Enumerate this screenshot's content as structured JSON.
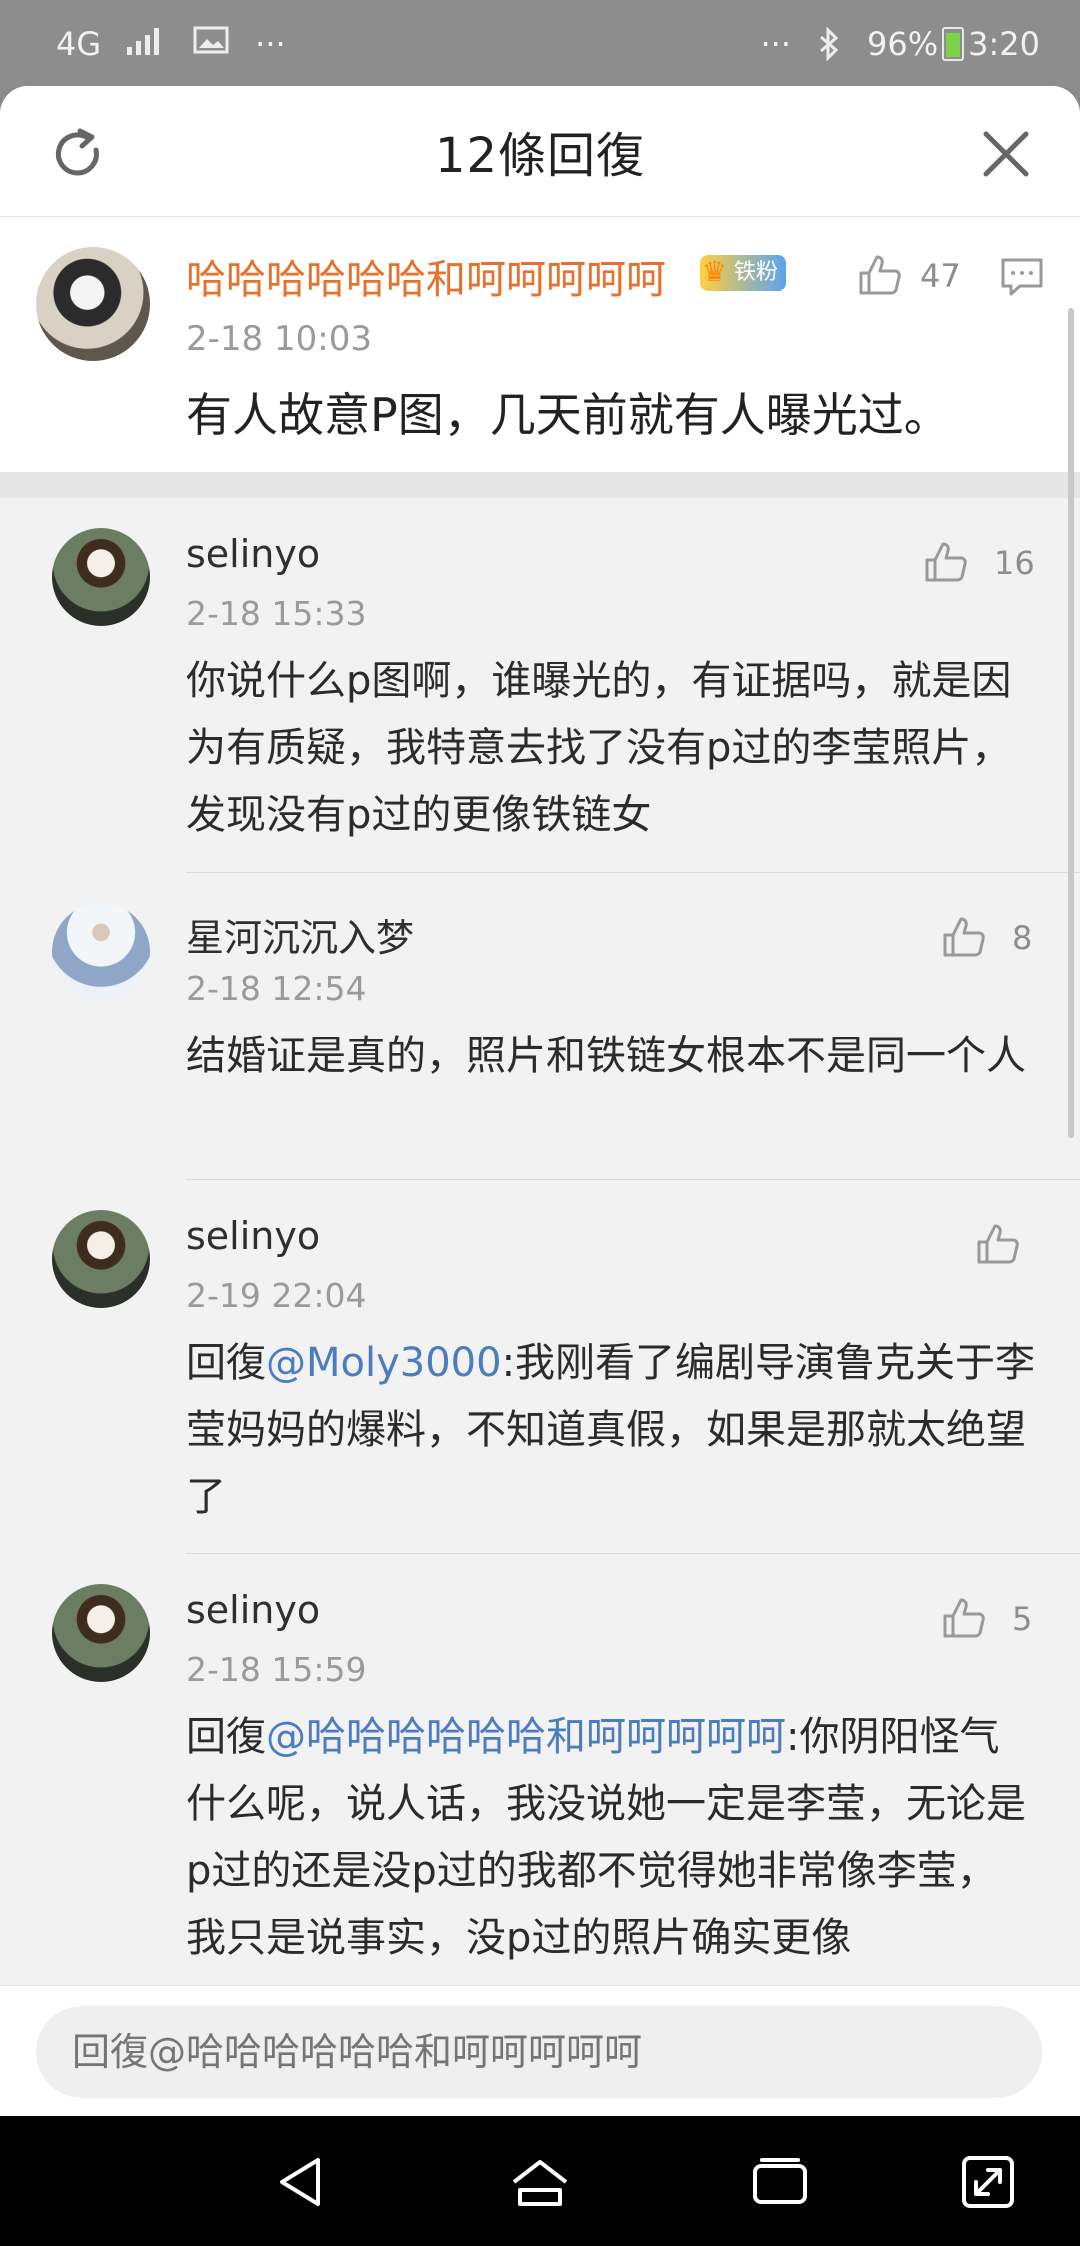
{
  "status_bar": {
    "network": "4G",
    "left_more": "···",
    "right_more": "···",
    "battery": "96%",
    "time": "3:20"
  },
  "header": {
    "title": "12條回復"
  },
  "main_comment": {
    "author": "哈哈哈哈哈哈和呵呵呵呵呵",
    "badge": "铁粉",
    "time": "2-18 10:03",
    "text": "有人故意P图，几天前就有人曝光过。",
    "likes": "47"
  },
  "replies": [
    {
      "author": "selinyo",
      "time": "2-18 15:33",
      "likes": "16",
      "prefix": "",
      "mention": "",
      "text": "你说什么p图啊，谁曝光的，有证据吗，就是因为有质疑，我特意去找了没有p过的李莹照片，发现没有p过的更像铁链女"
    },
    {
      "author": "星河沉沉入梦",
      "time": "2-18 12:54",
      "likes": "8",
      "prefix": "",
      "mention": "",
      "text": "结婚证是真的，照片和铁链女根本不是同一个人"
    },
    {
      "author": "selinyo",
      "time": "2-19 22:04",
      "likes": "",
      "prefix": "回復",
      "mention": "@Moly3000",
      "text": ":我刚看了编剧导演鲁克关于李莹妈妈的爆料，不知道真假，如果是那就太绝望了"
    },
    {
      "author": "selinyo",
      "time": "2-18 15:59",
      "likes": "5",
      "prefix": "回復",
      "mention": "@哈哈哈哈哈哈和呵呵呵呵呵",
      "text": ":你阴阳怪气什么呢，说人话，我没说她一定是李莹，无论是p过的还是没p过的我都不觉得她非常像李莹，我只是说事实，没p过的照片确实更像"
    }
  ],
  "reply_input": {
    "placeholder": "回復@哈哈哈哈哈哈和呵呵呵呵呵"
  },
  "icons": {
    "refresh": "refresh-icon",
    "close": "close-icon",
    "like": "thumbs-up-icon",
    "comment": "comment-icon",
    "back": "back-icon",
    "home": "home-icon",
    "recents": "recents-icon",
    "expand": "expand-icon"
  },
  "colors": {
    "author_highlight": "#e9702b",
    "mention": "#4b7cbf"
  }
}
